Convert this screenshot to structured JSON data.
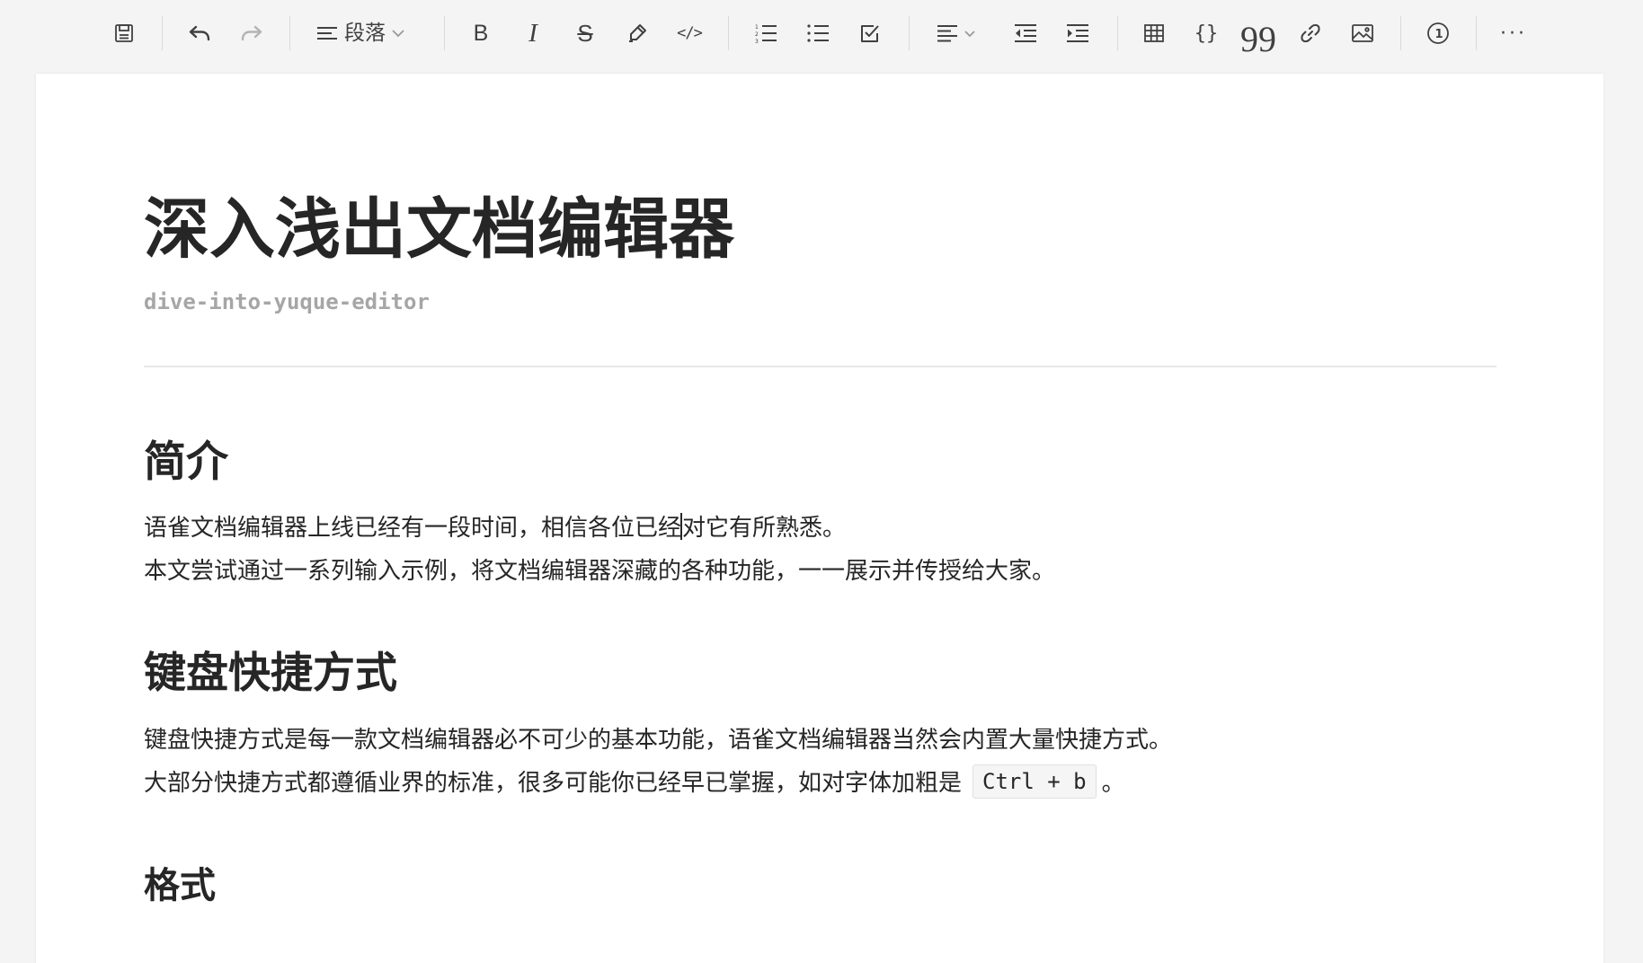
{
  "toolbar": {
    "paragraph_label": "段落"
  },
  "document": {
    "title": "深入浅出文档编辑器",
    "slug": "dive-into-yuque-editor",
    "sections": {
      "intro": {
        "heading": "简介",
        "line1_before_cursor": "语雀文档编辑器上线已经有一段时间，相信各位已经",
        "line1_after_cursor": "对它有所熟悉。",
        "line2": "本文尝试通过一系列输入示例，将文档编辑器深藏的各种功能，一一展示并传授给大家。"
      },
      "shortcuts": {
        "heading": "键盘快捷方式",
        "line1": "键盘快捷方式是每一款文档编辑器必不可少的基本功能，语雀文档编辑器当然会内置大量快捷方式。",
        "line2_before_code": "大部分快捷方式都遵循业界的标准，很多可能你已经早已掌握，如对字体加粗是",
        "line2_code": "Ctrl + b",
        "line2_after_code": "。"
      },
      "format": {
        "heading": "格式"
      }
    }
  },
  "icons": {
    "save": "save-icon",
    "undo": "undo-icon",
    "redo": "redo-icon",
    "paragraph": "paragraph-style-icon",
    "bold": "bold-icon",
    "italic": "italic-icon",
    "strikethrough": "strikethrough-icon",
    "highlight": "highlighter-icon",
    "code": "inline-code-icon",
    "ordered_list": "ordered-list-icon",
    "bullet_list": "bullet-list-icon",
    "task_list": "task-list-icon",
    "align": "align-left-icon",
    "outdent": "outdent-icon",
    "indent": "indent-icon",
    "table": "table-icon",
    "code_block": "code-block-icon",
    "quote": "quote-icon",
    "link": "link-icon",
    "image": "image-icon",
    "footnote": "footnote-icon",
    "more": "more-icon"
  }
}
